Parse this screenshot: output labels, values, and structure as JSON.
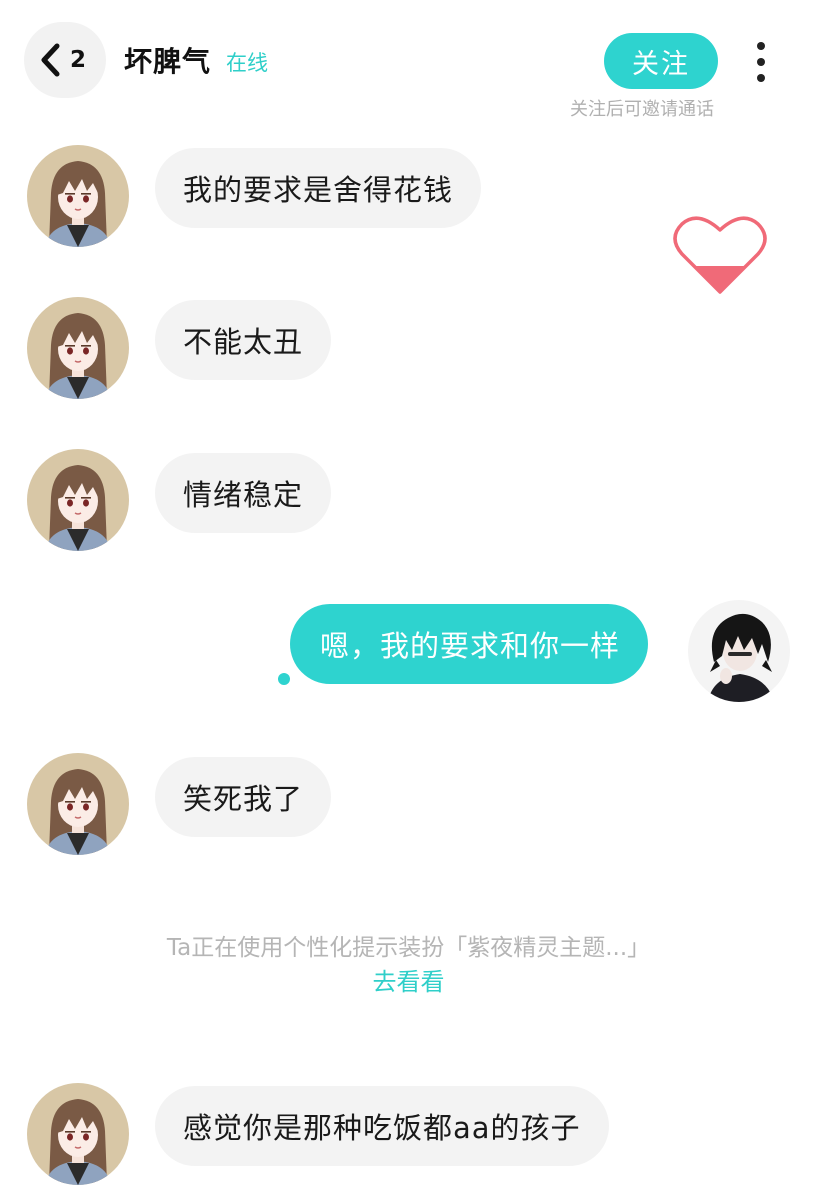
{
  "header": {
    "unread_count": "2",
    "contact_name": "坏脾气",
    "online_status": "在线",
    "follow_label": "关注",
    "follow_hint": "关注后可邀请通话"
  },
  "messages": [
    {
      "side": "incoming",
      "text": "我的要求是舍得花钱"
    },
    {
      "side": "incoming",
      "text": "不能太丑"
    },
    {
      "side": "incoming",
      "text": "情绪稳定"
    },
    {
      "side": "outgoing",
      "text": "嗯，我的要求和你一样"
    },
    {
      "side": "incoming",
      "text": "笑死我了"
    },
    {
      "side": "incoming",
      "text": "感觉你是那种吃饭都aa的孩子"
    }
  ],
  "notice": {
    "text": "Ta正在使用个性化提示装扮「紫夜精灵主题...」",
    "link": "去看看"
  },
  "colors": {
    "accent": "#2ed3cf",
    "incoming_bubble": "#f3f3f3",
    "hint_gray": "#b0b0b0",
    "heart": "#f06a78"
  },
  "icons": {
    "back": "chevron-left-icon",
    "more": "more-vertical-icon",
    "heart": "heart-icon"
  }
}
